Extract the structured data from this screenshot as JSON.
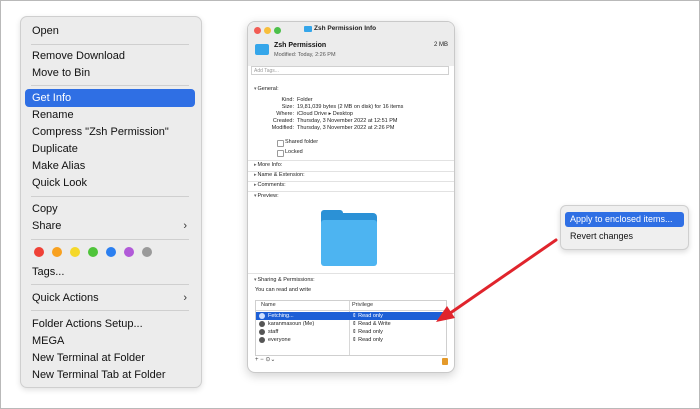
{
  "context_menu": {
    "items": [
      {
        "label": "Open"
      },
      {
        "label": "Remove Download"
      },
      {
        "label": "Move to Bin"
      },
      {
        "label": "Get Info"
      },
      {
        "label": "Rename"
      },
      {
        "label": "Compress \"Zsh Permission\""
      },
      {
        "label": "Duplicate"
      },
      {
        "label": "Make Alias"
      },
      {
        "label": "Quick Look"
      },
      {
        "label": "Copy"
      },
      {
        "label": "Share"
      },
      {
        "label": "Tags..."
      },
      {
        "label": "Quick Actions"
      },
      {
        "label": "Folder Actions Setup..."
      },
      {
        "label": "MEGA"
      },
      {
        "label": "New Terminal at Folder"
      },
      {
        "label": "New Terminal Tab at Folder"
      }
    ],
    "tag_colors": [
      "#ef4137",
      "#f8a120",
      "#f5d82a",
      "#4fc43a",
      "#2b7ff0",
      "#b15ad8",
      "#9a9a9a"
    ],
    "highlight_color": "#2f6fe4"
  },
  "info_window": {
    "title": "Zsh Permission Info",
    "name": "Zsh Permission",
    "size": "2 MB",
    "modified_short": "Modified: Today, 2:26 PM",
    "tags_placeholder": "Add Tags...",
    "general_label": "General:",
    "general": {
      "kind_label": "Kind:",
      "kind": "Folder",
      "size_label": "Size:",
      "size": "19,81,039 bytes (2 MB on disk) for 16 items",
      "where_label": "Where:",
      "where": "iCloud Drive ▸ Desktop",
      "created_label": "Created:",
      "created": "Thursday, 3 November 2022 at 12:51 PM",
      "modified_label": "Modified:",
      "modified": "Thursday, 3 November 2022 at 2:26 PM"
    },
    "shared_folder_label": "Shared folder",
    "locked_label": "Locked",
    "more_info_label": "More Info:",
    "name_ext_label": "Name & Extension:",
    "comments_label": "Comments:",
    "preview_label": "Preview:",
    "sharing_label": "Sharing & Permissions:",
    "sharing_note": "You can read and write",
    "perm_headers": {
      "name": "Name",
      "privilege": "Privilege"
    },
    "perm_rows": [
      {
        "name": "Fetching...",
        "privilege": "⇕ Read only"
      },
      {
        "name": "karanmasoun (Me)",
        "privilege": "⇕ Read & Write"
      },
      {
        "name": "staff",
        "privilege": "⇕ Read only"
      },
      {
        "name": "everyone",
        "privilege": "⇕ Read only"
      }
    ],
    "footer_controls": "+  −  ⊙⌄"
  },
  "popup_menu": {
    "items": [
      {
        "label": "Apply to enclosed items..."
      },
      {
        "label": "Revert changes"
      }
    ]
  },
  "colors": {
    "arrow": "#e0242c",
    "folder": "#35a6ea",
    "selection": "#1d5fd6"
  }
}
